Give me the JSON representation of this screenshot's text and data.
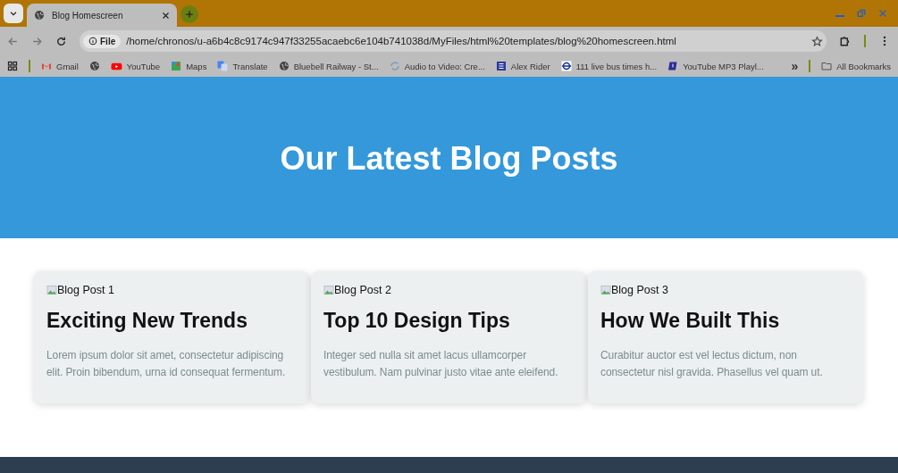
{
  "browser": {
    "tab": {
      "title": "Blog Homescreen",
      "selected": true
    },
    "address": {
      "badge": "File",
      "url": "/home/chronos/u-a6b4c8c9174c947f33255acaebc6e104b741038d/MyFiles/html%20templates/blog%20homescreen.html"
    },
    "bookmarks": [
      {
        "label": "Gmail",
        "kind": "gmail"
      },
      {
        "kind": "globe"
      },
      {
        "label": "YouTube",
        "kind": "youtube"
      },
      {
        "label": "Maps",
        "kind": "maps"
      },
      {
        "label": "Translate",
        "kind": "translate"
      },
      {
        "label": "Bluebell Railway - St...",
        "kind": "globe"
      },
      {
        "label": "Audio to Video: Cre...",
        "kind": "refresh"
      },
      {
        "label": "Alex Rider",
        "kind": "doc"
      },
      {
        "label": "111 live bus times h...",
        "kind": "roundel"
      },
      {
        "label": "YouTube MP3 Playl...",
        "kind": "note"
      }
    ],
    "overflow": "»",
    "all_bookmarks": "All Bookmarks"
  },
  "hero": {
    "title": "Our Latest Blog Posts"
  },
  "posts": [
    {
      "image_alt": "Blog Post 1",
      "title": "Exciting New Trends",
      "text": "Lorem ipsum dolor sit amet, consectetur adipiscing elit. Proin bibendum, urna id consequat fermentum."
    },
    {
      "image_alt": "Blog Post 2",
      "title": "Top 10 Design Tips",
      "text": "Integer sed nulla sit amet lacus ullamcorper vestibulum. Nam pulvinar justo vitae ante eleifend."
    },
    {
      "image_alt": "Blog Post 3",
      "title": "How We Built This",
      "text": "Curabitur auctor est vel lectus dictum, non consectetur nisl gravida. Phasellus vel quam ut."
    }
  ]
}
